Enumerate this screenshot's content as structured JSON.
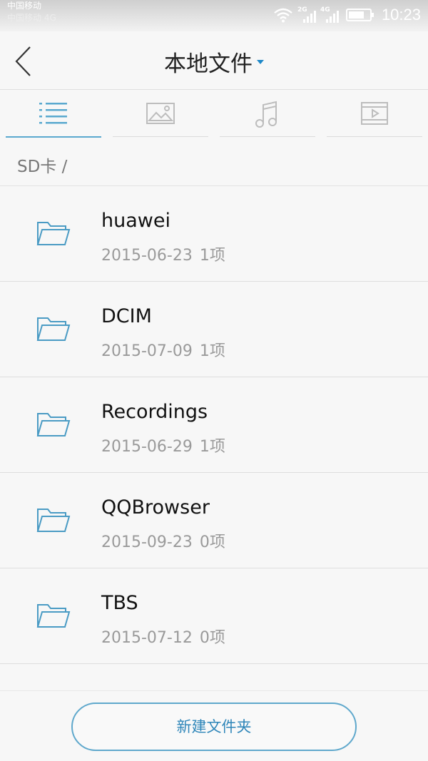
{
  "status_bar": {
    "carrier_1": "中国移动",
    "carrier_2": "中国移动 4G",
    "net_1": "2G",
    "net_2": "4G",
    "time": "10:23",
    "battery_level": 0.75,
    "icons": [
      "wifi-icon",
      "signal-2g-icon",
      "signal-4g-icon",
      "battery-icon"
    ]
  },
  "header": {
    "title": "本地文件",
    "back_icon": "chevron-left-icon",
    "dropdown_icon": "caret-down-icon"
  },
  "tabs": [
    {
      "name": "list",
      "icon": "list-icon",
      "active": true
    },
    {
      "name": "images",
      "icon": "image-icon",
      "active": false
    },
    {
      "name": "music",
      "icon": "music-icon",
      "active": false
    },
    {
      "name": "video",
      "icon": "video-icon",
      "active": false
    }
  ],
  "breadcrumb": "SD卡 /",
  "folders": [
    {
      "name": "huawei",
      "date": "2015-06-23",
      "count": "1项"
    },
    {
      "name": "DCIM",
      "date": "2015-07-09",
      "count": "1项"
    },
    {
      "name": "Recordings",
      "date": "2015-06-29",
      "count": "1项"
    },
    {
      "name": "QQBrowser",
      "date": "2015-09-23",
      "count": "0项"
    },
    {
      "name": "TBS",
      "date": "2015-07-12",
      "count": "0项"
    }
  ],
  "new_folder_button": "新建文件夹",
  "colors": {
    "accent": "#5aa9cf",
    "button_text": "#2f86b9",
    "folder_stroke": "#4a9bc4"
  }
}
